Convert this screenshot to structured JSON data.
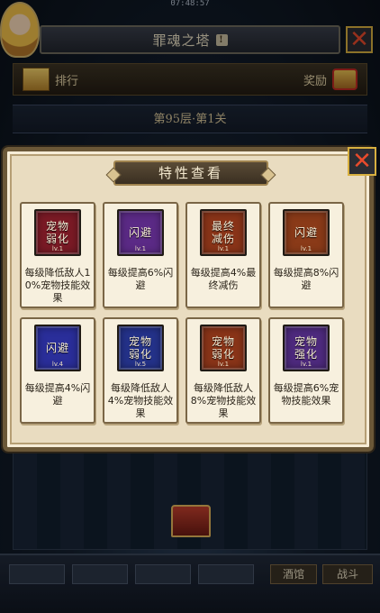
{
  "status_bar": {
    "time": "07:48:57"
  },
  "header": {
    "title": "罪魂之塔",
    "info_icon": "info-icon",
    "info_glyph": "!"
  },
  "rank_bar": {
    "rank_label": "排行",
    "reward_label": "奖励"
  },
  "floor": {
    "label": "第95层·第1关"
  },
  "bottom_bar": {
    "tab_a": "酒馆",
    "tab_b": "战斗"
  },
  "dialog": {
    "title": "特性查看",
    "close_glyph": "✕",
    "traits": [
      {
        "name": "宠物弱化",
        "level": "lv.1",
        "desc": "每级降低敌人10%宠物技能效果",
        "color": "#7a1a25"
      },
      {
        "name": "闪避",
        "level": "lv.1",
        "desc": "每级提高6%闪避",
        "color": "#5b2a86"
      },
      {
        "name": "最终减伤",
        "level": "lv.1",
        "desc": "每级提高4%最终减伤",
        "color": "#8a3418"
      },
      {
        "name": "闪避",
        "level": "lv.1",
        "desc": "每级提高8%闪避",
        "color": "#8a3a18"
      },
      {
        "name": "闪避",
        "level": "lv.4",
        "desc": "每级提高4%闪避",
        "color": "#2a2e9a"
      },
      {
        "name": "宠物弱化",
        "level": "lv.5",
        "desc": "每级降低敌人4%宠物技能效果",
        "color": "#24328a"
      },
      {
        "name": "宠物弱化",
        "level": "lv.1",
        "desc": "每级降低敌人8%宠物技能效果",
        "color": "#8a3418"
      },
      {
        "name": "宠物强化",
        "level": "lv.1",
        "desc": "每级提高6%宠物技能效果",
        "color": "#4e2a7e"
      }
    ]
  }
}
